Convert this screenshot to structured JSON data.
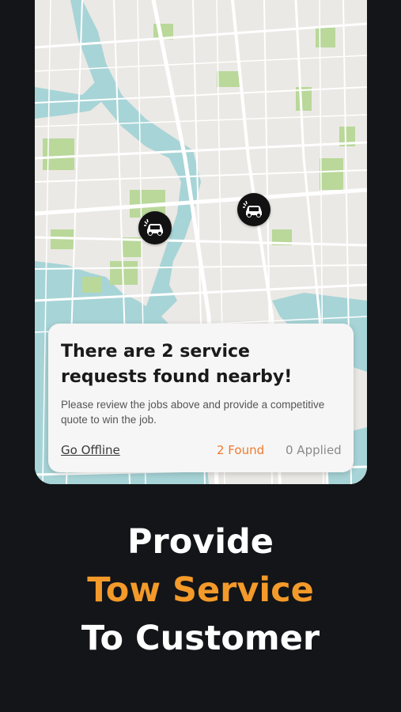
{
  "colors": {
    "background": "#131518",
    "map_land": "#ebe9e5",
    "map_water": "#a7d4d7",
    "map_park": "#b9d89a",
    "accent_orange": "#f39a2a",
    "found_orange": "#f07a2e"
  },
  "map": {
    "markers": [
      {
        "icon": "tow-request-icon"
      },
      {
        "icon": "tow-request-icon"
      }
    ]
  },
  "card": {
    "title": "There are 2 service requests found nearby!",
    "description": "Please review the jobs above and provide a competitive quote to win the job.",
    "go_offline_label": "Go Offline",
    "found_label": "2 Found",
    "applied_label": "0 Applied"
  },
  "promo": {
    "line1": "Provide",
    "line2": "Tow Service",
    "line3": "To Customer"
  }
}
